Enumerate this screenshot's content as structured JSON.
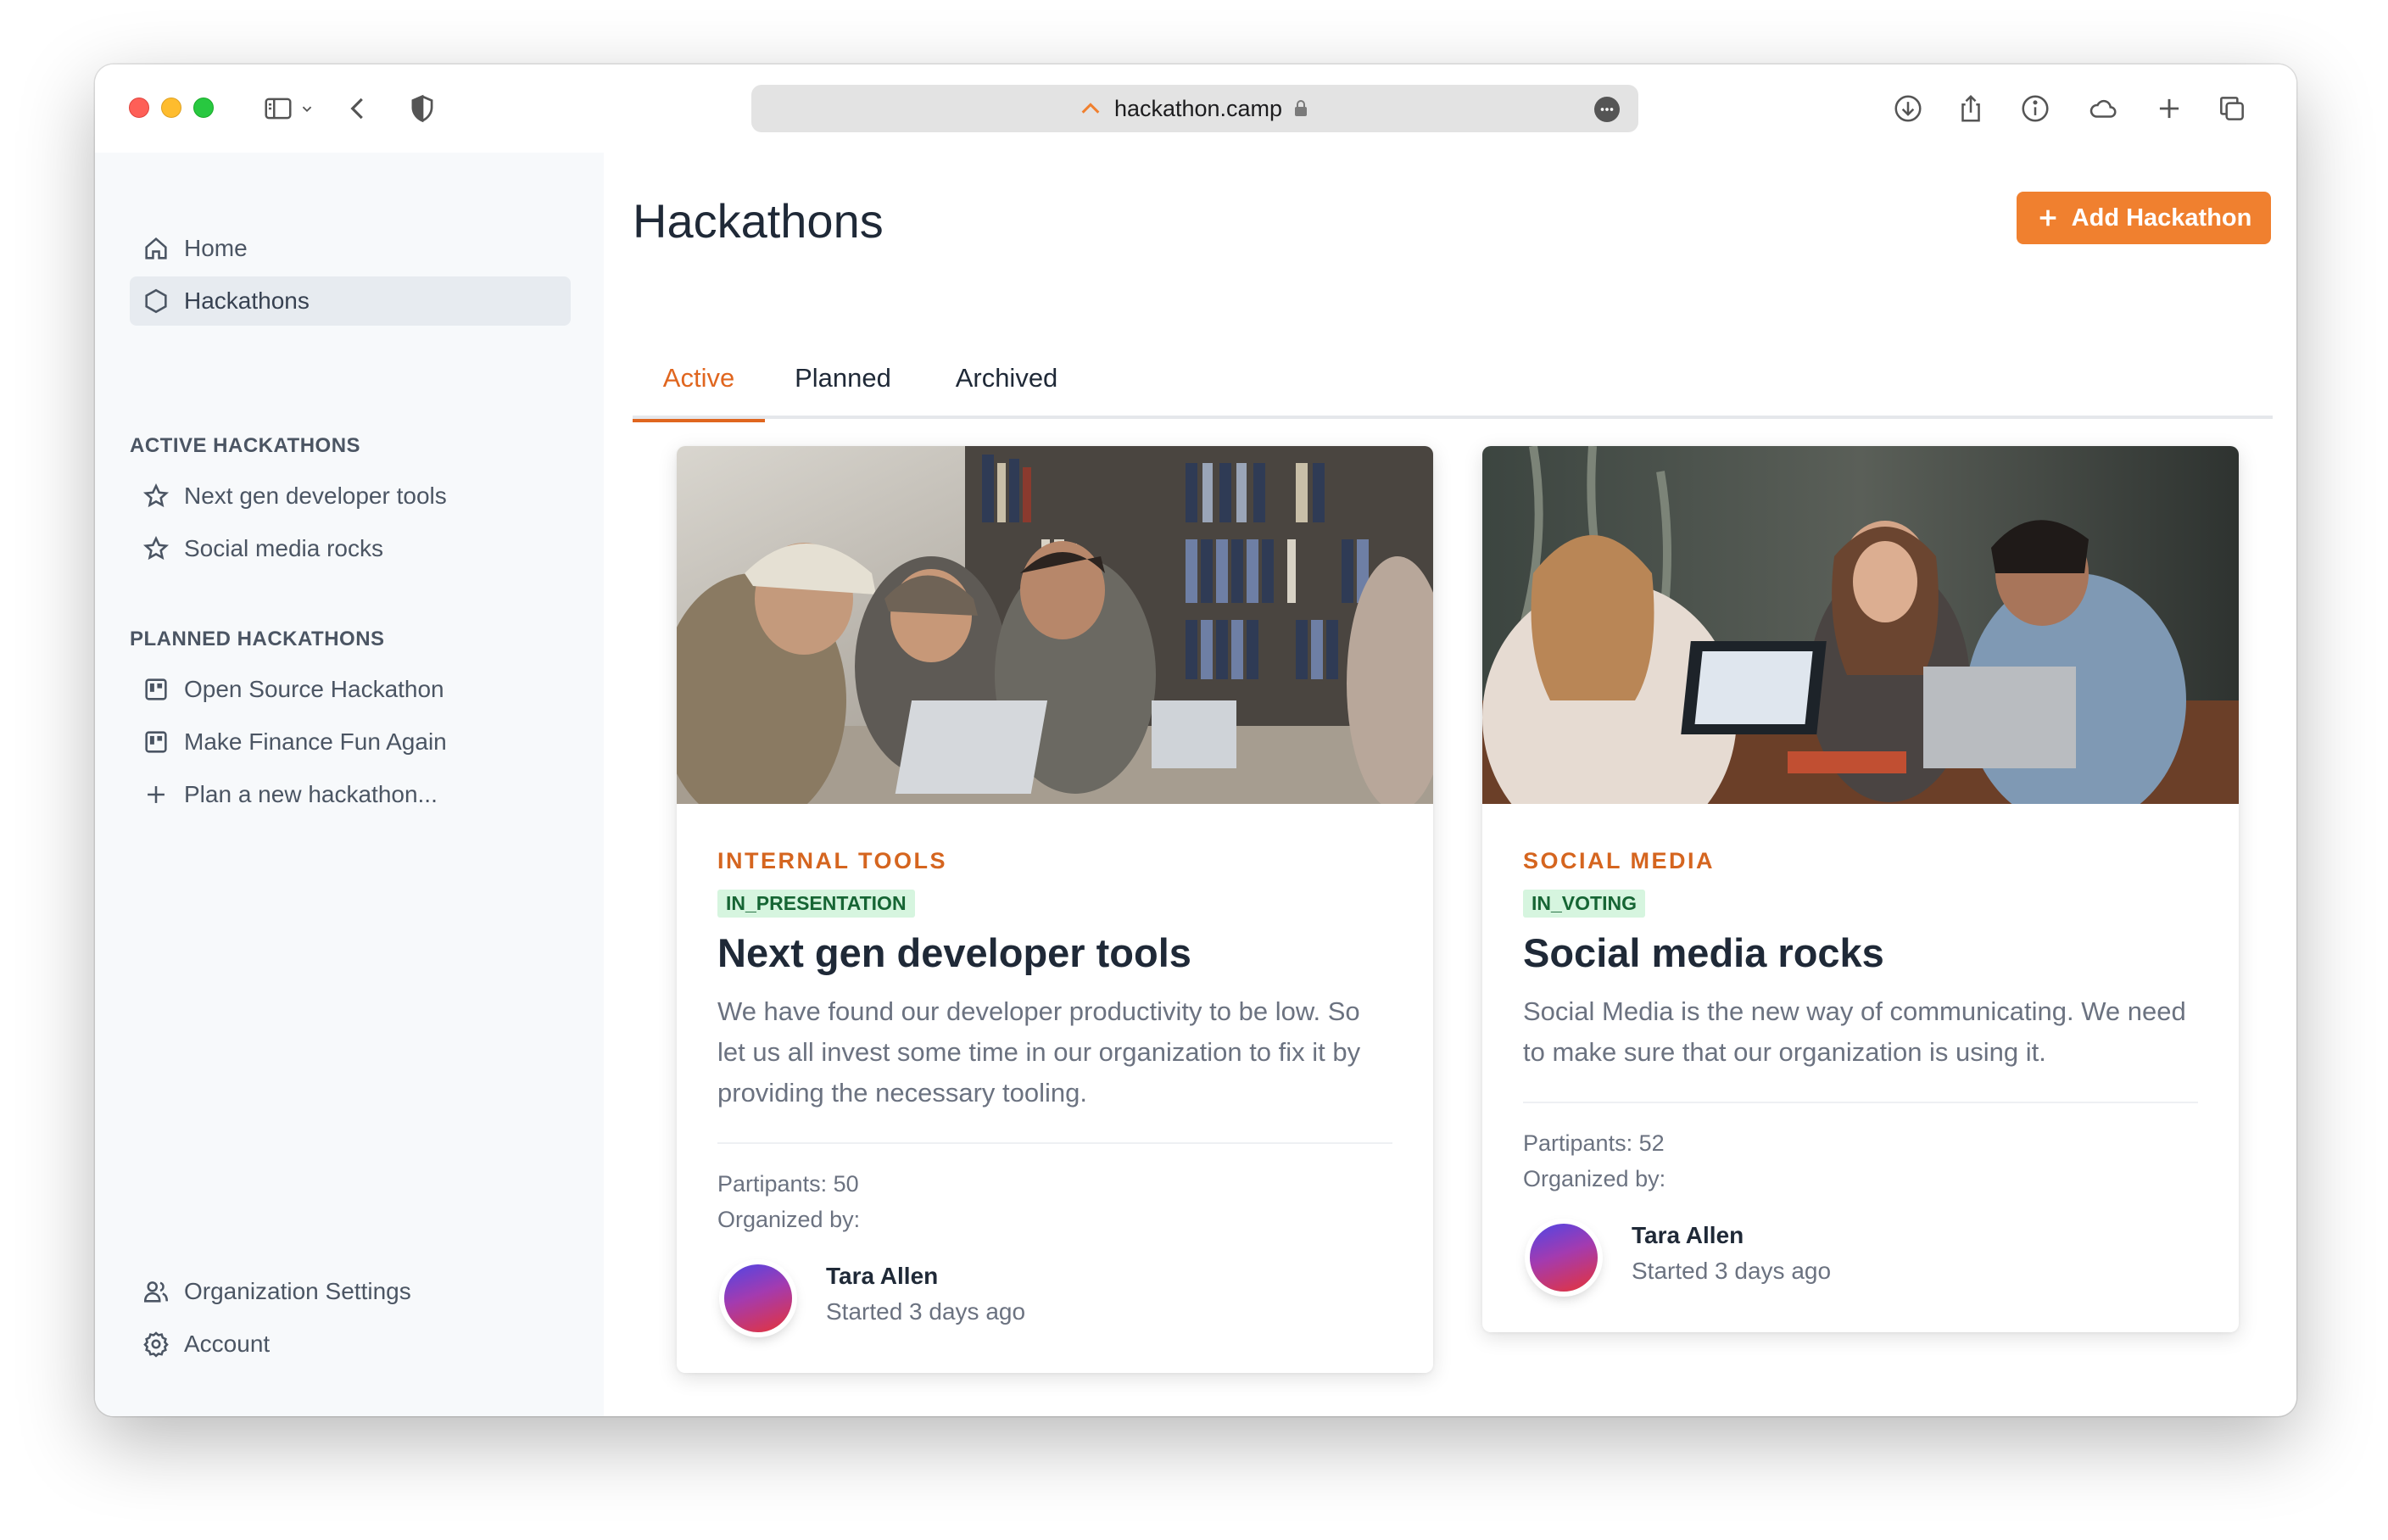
{
  "browser": {
    "url": "hackathon.camp"
  },
  "sidebar": {
    "main": [
      {
        "label": "Home",
        "icon": "home-icon"
      },
      {
        "label": "Hackathons",
        "icon": "hexagon-icon",
        "active": true
      }
    ],
    "active_heading": "ACTIVE HACKATHONS",
    "active_items": [
      {
        "label": "Next gen developer tools",
        "icon": "star-icon"
      },
      {
        "label": "Social media rocks",
        "icon": "star-icon"
      }
    ],
    "planned_heading": "PLANNED HACKATHONS",
    "planned_items": [
      {
        "label": "Open Source Hackathon",
        "icon": "board-icon"
      },
      {
        "label": "Make Finance Fun Again",
        "icon": "board-icon"
      },
      {
        "label": "Plan a new hackathon...",
        "icon": "plus-icon"
      }
    ],
    "bottom_items": [
      {
        "label": "Organization Settings",
        "icon": "users-icon"
      },
      {
        "label": "Account",
        "icon": "gear-icon"
      }
    ]
  },
  "main": {
    "title": "Hackathons",
    "add_button": "Add Hackathon",
    "tabs": [
      {
        "label": "Active",
        "active": true
      },
      {
        "label": "Planned"
      },
      {
        "label": "Archived"
      }
    ],
    "cards": [
      {
        "category": "INTERNAL TOOLS",
        "status": "IN_PRESENTATION",
        "title": "Next gen developer tools",
        "description": "We have found our developer productivity to be low. So let us all invest some time in our organization to fix it by providing the necessary tooling.",
        "participants": "Partipants: 50",
        "organized_by": "Organized by:",
        "organizer_name": "Tara Allen",
        "started": "Started 3 days ago"
      },
      {
        "category": "SOCIAL MEDIA",
        "status": "IN_VOTING",
        "title": "Social media rocks",
        "description": "Social Media is the new way of communicating. We need to make sure that our organization is using it.",
        "participants": "Partipants: 52",
        "organized_by": "Organized by:",
        "organizer_name": "Tara Allen",
        "started": "Started 3 days ago"
      }
    ]
  },
  "colors": {
    "accent": "#f0802f",
    "accent_text": "#d5651f",
    "status_bg": "#d6f5df",
    "status_text": "#166534",
    "sidebar_bg": "#f7f9fb"
  }
}
